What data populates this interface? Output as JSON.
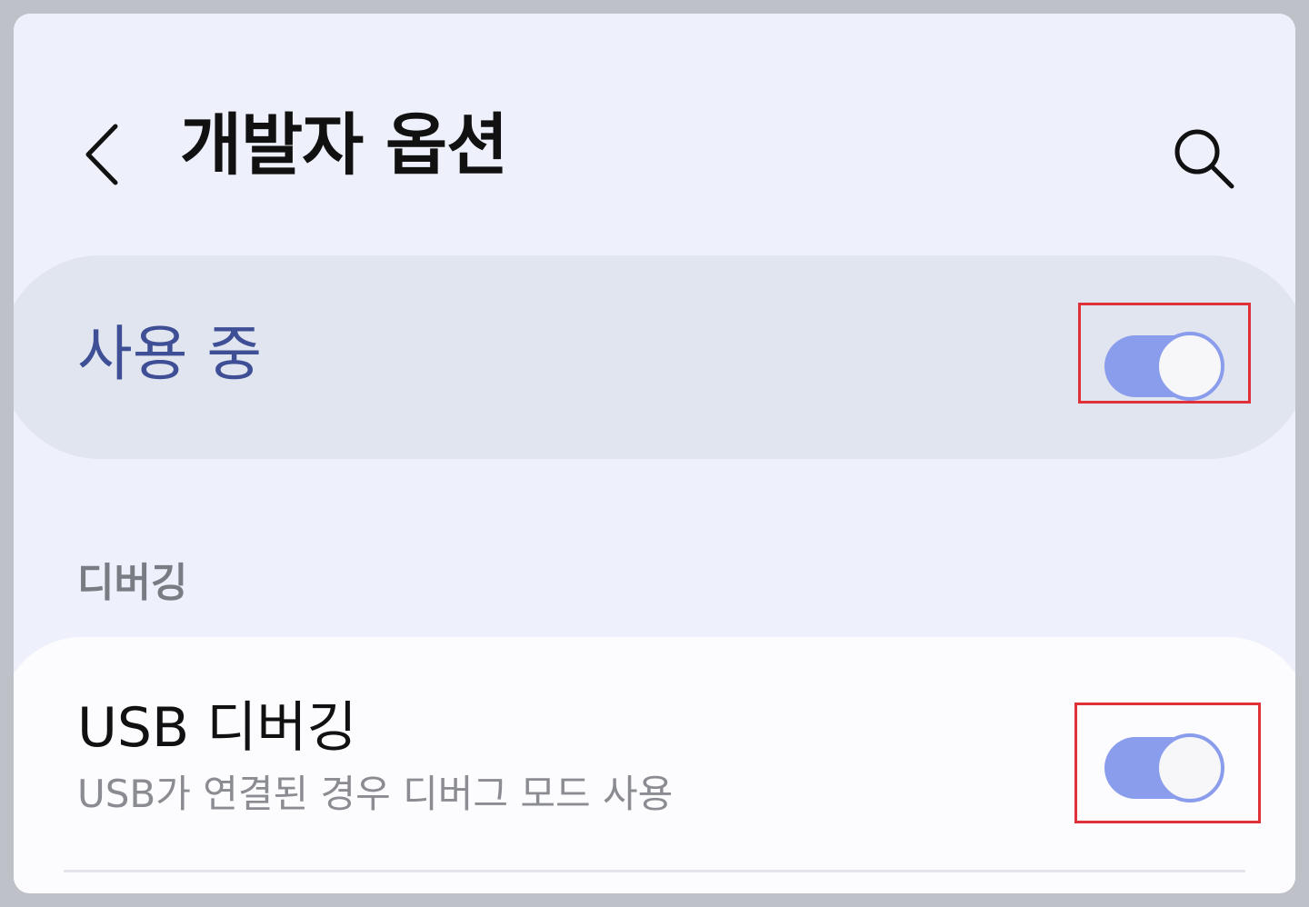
{
  "header": {
    "title": "개발자 옵션",
    "back_icon": "chevron-left-icon",
    "search_icon": "search-icon"
  },
  "master_switch": {
    "label": "사용 중",
    "state": "on"
  },
  "sections": [
    {
      "header": "디버깅",
      "items": [
        {
          "title": "USB 디버깅",
          "summary": "USB가 연결된 경우 디버그 모드 사용",
          "state": "on"
        }
      ]
    }
  ],
  "colors": {
    "accent": "#8a9cec",
    "master_label": "#3e4f96",
    "highlight": "#e0303a"
  }
}
